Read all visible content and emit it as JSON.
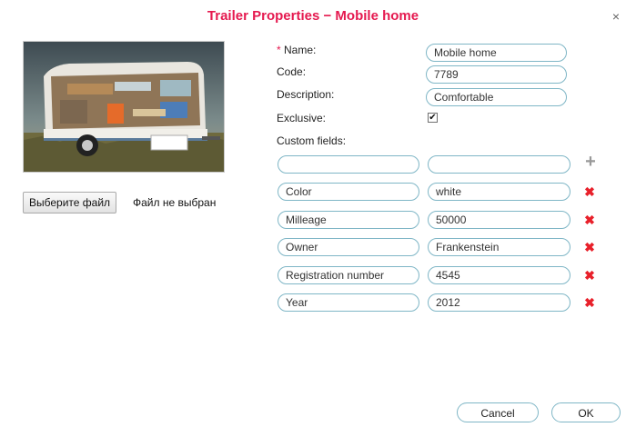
{
  "dialog": {
    "title": "Trailer Properties − Mobile home",
    "close_icon": "×"
  },
  "file": {
    "button_label": "Выберите файл",
    "status": "Файл не выбран"
  },
  "form": {
    "required_mark": "*",
    "name_label": " Name:",
    "name_value": "Mobile home",
    "code_label": "Code:",
    "code_value": "7789",
    "description_label": "Description:",
    "description_value": "Comfortable",
    "exclusive_label": "Exclusive:",
    "exclusive_checked": true,
    "exclusive_mark": "✔",
    "custom_fields_label": "Custom fields:"
  },
  "custom_fields": {
    "new_name": "",
    "new_value": "",
    "add_icon": "+",
    "delete_icon": "✖",
    "items": [
      {
        "name": "Color",
        "value": "white"
      },
      {
        "name": "Milleage",
        "value": "50000"
      },
      {
        "name": "Owner",
        "value": "Frankenstein"
      },
      {
        "name": "Registration number",
        "value": "4545"
      },
      {
        "name": "Year",
        "value": "2012"
      }
    ]
  },
  "actions": {
    "cancel_label": "Cancel",
    "ok_label": "OK"
  },
  "colors": {
    "title": "#e5194f",
    "input_border": "#7fb6c6",
    "delete": "#e8202a"
  }
}
